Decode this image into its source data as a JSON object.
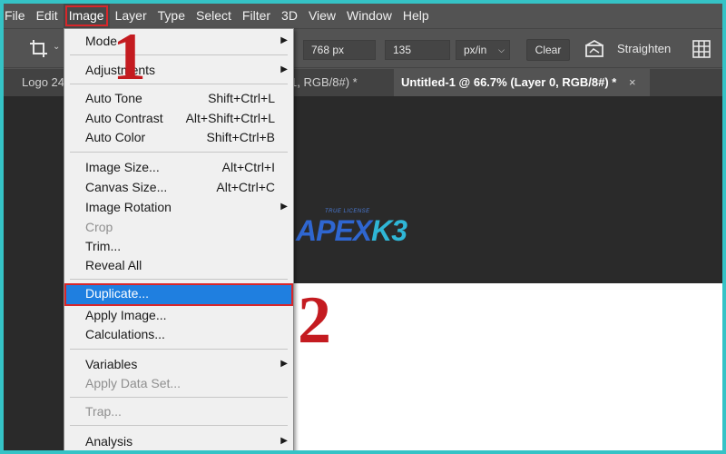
{
  "menubar": {
    "items": [
      {
        "label": "File",
        "name": "menu-file"
      },
      {
        "label": "Edit",
        "name": "menu-edit"
      },
      {
        "label": "Image",
        "name": "menu-image"
      },
      {
        "label": "Layer",
        "name": "menu-layer"
      },
      {
        "label": "Type",
        "name": "menu-type"
      },
      {
        "label": "Select",
        "name": "menu-select"
      },
      {
        "label": "Filter",
        "name": "menu-filter"
      },
      {
        "label": "3D",
        "name": "menu-3d"
      },
      {
        "label": "View",
        "name": "menu-view"
      },
      {
        "label": "Window",
        "name": "menu-window"
      },
      {
        "label": "Help",
        "name": "menu-help"
      }
    ]
  },
  "options": {
    "width_value": "768 px",
    "resolution_value": "135",
    "unit": "px/in",
    "clear": "Clear",
    "straighten": "Straighten"
  },
  "tabs": {
    "logo": "Logo 24",
    "mid": "1, RGB/8#) *",
    "active": "Untitled-1 @ 66.7% (Layer 0, RGB/8#) *",
    "close": "×"
  },
  "watermark": {
    "small": "TRUE LICENSE",
    "apex": "APEX",
    "k3": "K3"
  },
  "image_menu": {
    "mode": "Mode",
    "adjustments": "Adjustments",
    "auto_tone": "Auto Tone",
    "auto_tone_sc": "Shift+Ctrl+L",
    "auto_contrast": "Auto Contrast",
    "auto_contrast_sc": "Alt+Shift+Ctrl+L",
    "auto_color": "Auto Color",
    "auto_color_sc": "Shift+Ctrl+B",
    "image_size": "Image Size...",
    "image_size_sc": "Alt+Ctrl+I",
    "canvas_size": "Canvas Size...",
    "canvas_size_sc": "Alt+Ctrl+C",
    "image_rotation": "Image Rotation",
    "crop": "Crop",
    "trim": "Trim...",
    "reveal_all": "Reveal All",
    "duplicate": "Duplicate...",
    "apply_image": "Apply Image...",
    "calculations": "Calculations...",
    "variables": "Variables",
    "apply_data_set": "Apply Data Set...",
    "trap": "Trap...",
    "analysis": "Analysis"
  },
  "steps": {
    "one": "1",
    "two": "2"
  },
  "colors": {
    "frame_border": "#35c3c6",
    "highlight": "#1f7fe0",
    "annotation_red": "#c41b20"
  }
}
